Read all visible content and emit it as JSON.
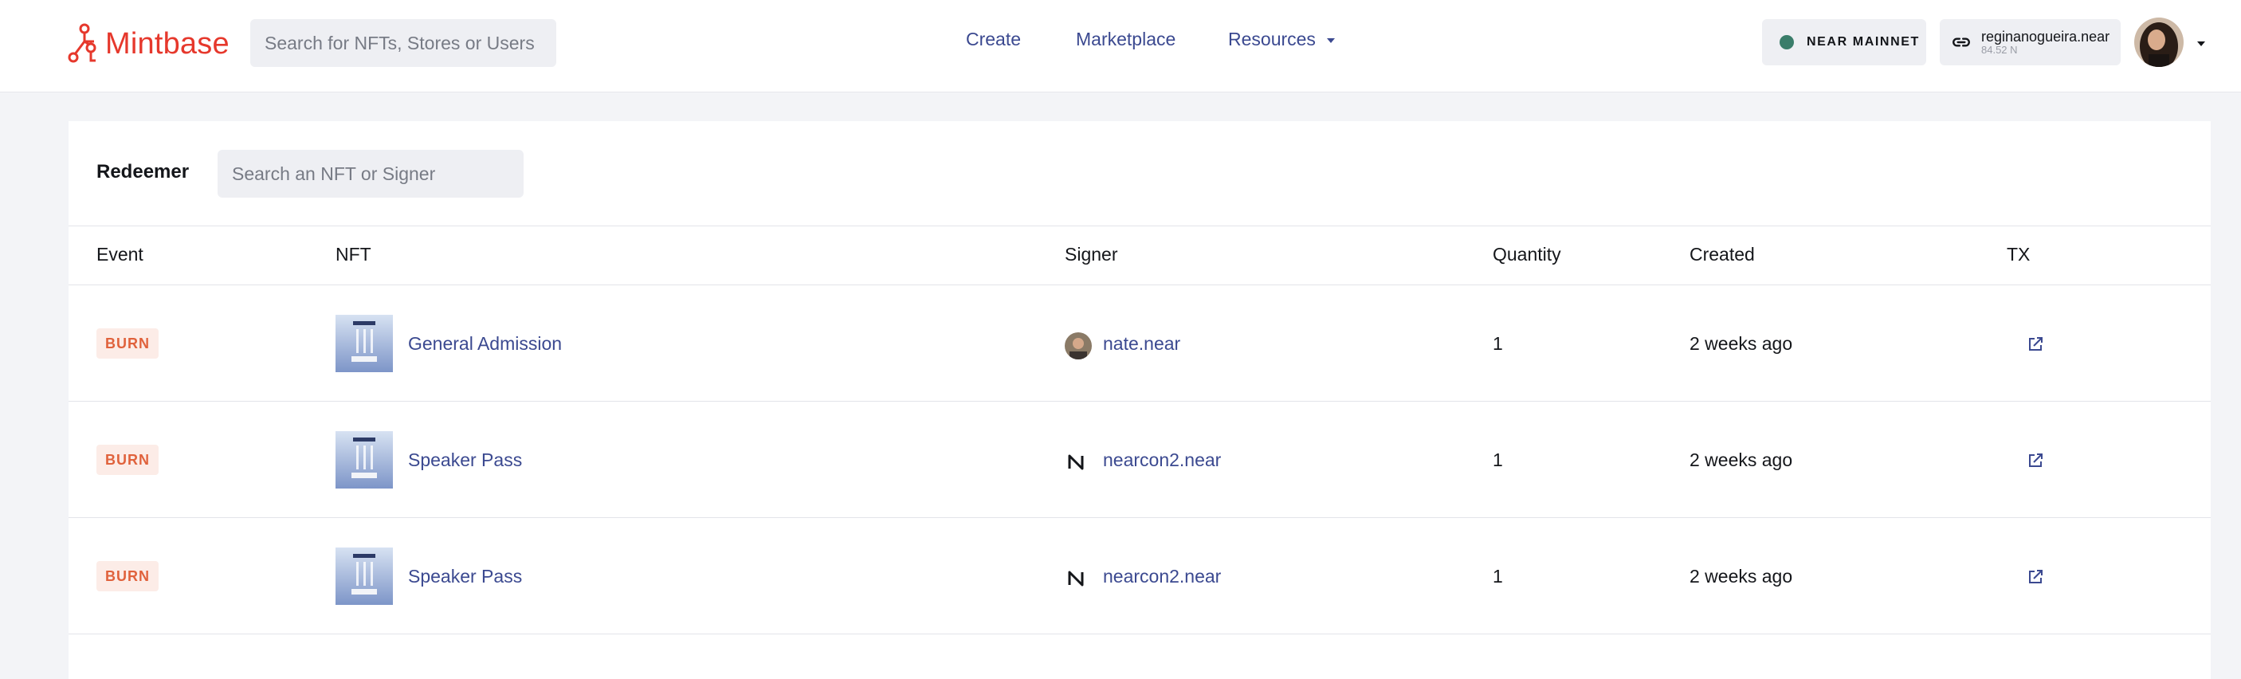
{
  "header": {
    "logo_text": "Mintbase",
    "search_placeholder": "Search for NFTs, Stores or Users",
    "nav": {
      "create": "Create",
      "marketplace": "Marketplace",
      "resources": "Resources"
    },
    "network_label": "NEAR MAINNET",
    "account_name": "reginanogueira.near",
    "account_balance": "84.52 N"
  },
  "panel": {
    "title": "Redeemer",
    "search_placeholder": "Search an NFT or Signer",
    "columns": {
      "event": "Event",
      "nft": "NFT",
      "signer": "Signer",
      "quantity": "Quantity",
      "created": "Created",
      "tx": "TX"
    },
    "rows": [
      {
        "event": "BURN",
        "nft": "General Admission",
        "signer": "nate.near",
        "signer_icon": "user-avatar",
        "quantity": "1",
        "created": "2 weeks ago"
      },
      {
        "event": "BURN",
        "nft": "Speaker Pass",
        "signer": "nearcon2.near",
        "signer_icon": "near-logo-icon",
        "quantity": "1",
        "created": "2 weeks ago"
      },
      {
        "event": "BURN",
        "nft": "Speaker Pass",
        "signer": "nearcon2.near",
        "signer_icon": "near-logo-icon",
        "quantity": "1",
        "created": "2 weeks ago"
      }
    ]
  },
  "colors": {
    "brand": "#e6382c",
    "link": "#3b4990",
    "burn": "#e0623c",
    "network_dot": "#3a7d6a"
  }
}
